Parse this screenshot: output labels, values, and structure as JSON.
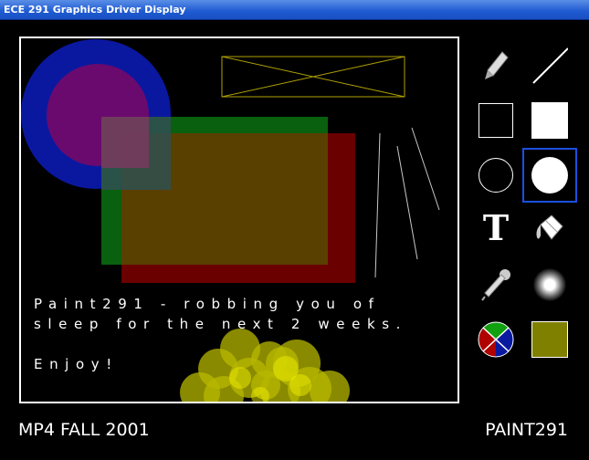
{
  "window": {
    "title": "ECE 291 Graphics Driver Display"
  },
  "canvas": {
    "text_lines": [
      "Paint291 - robbing you of",
      "sleep for the next 2 weeks.",
      "",
      "Enjoy!"
    ]
  },
  "tools": [
    {
      "name": "pencil",
      "icon": "pencil-icon",
      "selected": false
    },
    {
      "name": "line",
      "icon": "line-icon",
      "selected": false
    },
    {
      "name": "rectangle",
      "icon": "rectangle-outline-icon",
      "selected": false
    },
    {
      "name": "filled-rectangle",
      "icon": "rectangle-filled-icon",
      "selected": false
    },
    {
      "name": "circle",
      "icon": "circle-outline-icon",
      "selected": false
    },
    {
      "name": "filled-circle",
      "icon": "circle-filled-icon",
      "selected": true
    },
    {
      "name": "text",
      "icon": "text-icon",
      "selected": false
    },
    {
      "name": "fill",
      "icon": "paint-bucket-icon",
      "selected": false
    },
    {
      "name": "eyedropper",
      "icon": "eyedropper-icon",
      "selected": false
    },
    {
      "name": "airbrush",
      "icon": "airbrush-icon",
      "selected": false
    },
    {
      "name": "color-picker",
      "icon": "color-wheel-icon",
      "selected": false
    },
    {
      "name": "current-color",
      "icon": "current-color-swatch",
      "selected": false
    }
  ],
  "text_tool_glyph": "T",
  "current_color": "#808000",
  "colors": {
    "accent": "#1a4fe0",
    "background": "#000000",
    "foreground": "#ffffff"
  },
  "footer": {
    "left": "MP4 FALL 2001",
    "right": "PAINT291"
  }
}
